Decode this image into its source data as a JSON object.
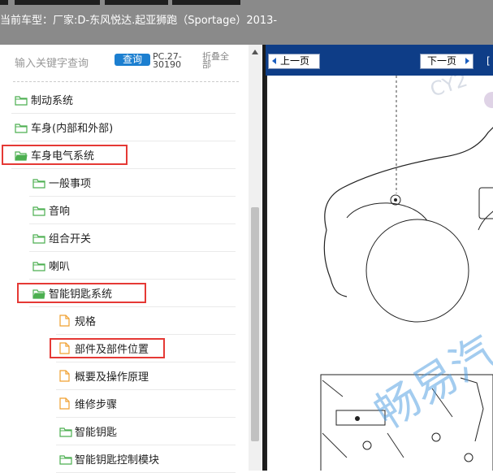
{
  "header": {
    "car_label": "当前车型：",
    "car_value": "厂家:D-东风悦达.起亚狮跑（Sportage）2013-"
  },
  "search": {
    "placeholder": "输入关键字查询",
    "query_button": "查询",
    "pc_code": "PC.27-30190",
    "collapse_all": "折叠全部"
  },
  "tree": [
    {
      "label": "制动系统",
      "level": 0,
      "type": "folder",
      "highlighted": false
    },
    {
      "label": "车身(内部和外部)",
      "level": 0,
      "type": "folder",
      "highlighted": false
    },
    {
      "label": "车身电气系统",
      "level": 0,
      "type": "folder-open",
      "highlighted": true
    },
    {
      "label": "一般事项",
      "level": 1,
      "type": "folder",
      "highlighted": false
    },
    {
      "label": "音响",
      "level": 1,
      "type": "folder",
      "highlighted": false
    },
    {
      "label": "组合开关",
      "level": 1,
      "type": "folder",
      "highlighted": false
    },
    {
      "label": "喇叭",
      "level": 1,
      "type": "folder",
      "highlighted": false
    },
    {
      "label": "智能钥匙系统",
      "level": 1,
      "type": "folder-open",
      "highlighted": true
    },
    {
      "label": "规格",
      "level": 2,
      "type": "document",
      "highlighted": false
    },
    {
      "label": "部件及部件位置",
      "level": 2,
      "type": "document",
      "highlighted": true
    },
    {
      "label": "概要及操作原理",
      "level": 2,
      "type": "document",
      "highlighted": false
    },
    {
      "label": "维修步骤",
      "level": 2,
      "type": "document",
      "highlighted": false
    },
    {
      "label": "智能钥匙",
      "level": 2,
      "type": "folder",
      "highlighted": false
    },
    {
      "label": "智能钥匙控制模块",
      "level": 2,
      "type": "folder",
      "highlighted": false
    }
  ],
  "viewer": {
    "prev_page": "上一页",
    "next_page": "下一页",
    "extra": "[",
    "watermark_top": "CY2",
    "watermark_main": "畅易汽"
  },
  "colors": {
    "folder": "#4caf50",
    "document": "#f0a030",
    "highlight": "#e53935",
    "nav": "#0e3d87",
    "query": "#1c7fd0"
  }
}
